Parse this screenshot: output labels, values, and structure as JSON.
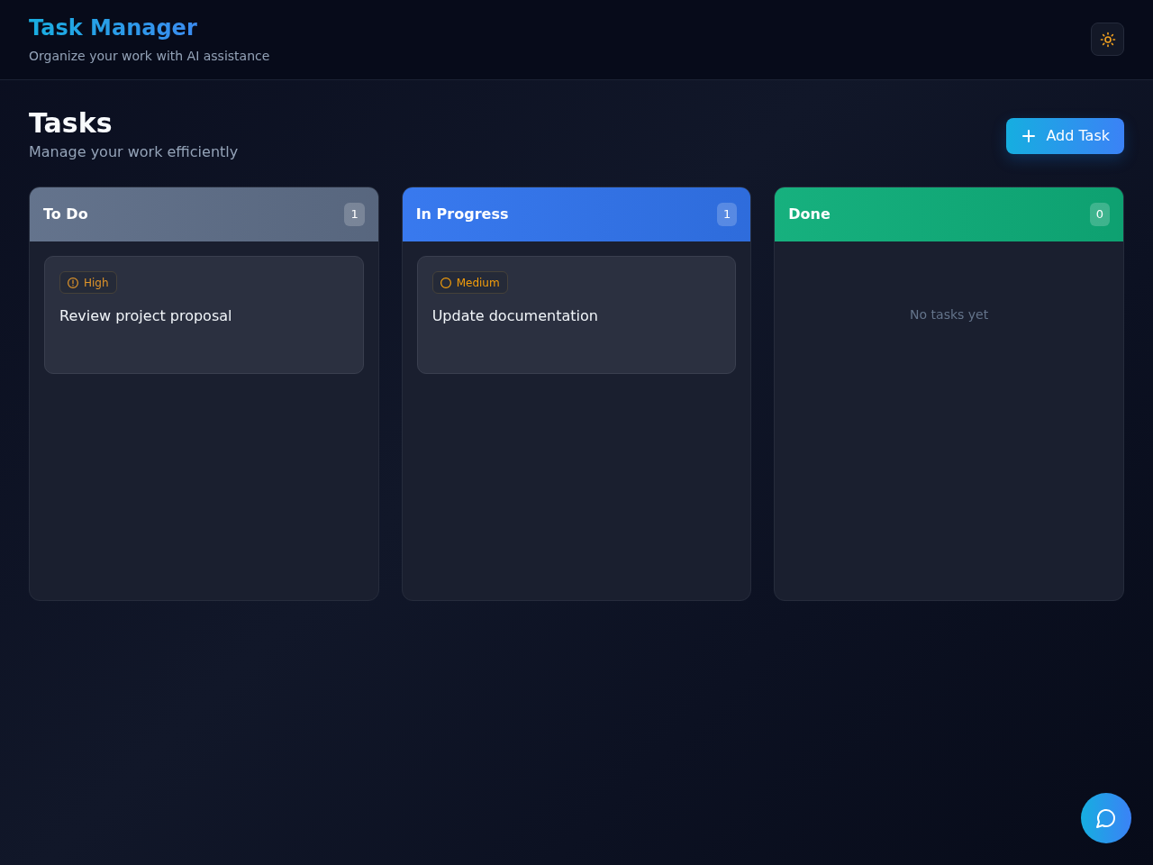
{
  "header": {
    "title": "Task Manager",
    "subtitle": "Organize your work with AI assistance"
  },
  "page": {
    "title": "Tasks",
    "subtitle": "Manage your work efficiently",
    "add_button": "Add Task"
  },
  "columns": [
    {
      "title": "To Do",
      "count": "1",
      "color": "#5f6f89",
      "tasks": [
        {
          "title": "Review project proposal",
          "priority": {
            "label": "High",
            "kind": "high"
          }
        }
      ]
    },
    {
      "title": "In Progress",
      "count": "1",
      "color": "#3275ee",
      "tasks": [
        {
          "title": "Update documentation",
          "priority": {
            "label": "Medium",
            "kind": "medium"
          }
        }
      ]
    },
    {
      "title": "Done",
      "count": "0",
      "color": "#0fae7a",
      "empty_text": "No tasks yet"
    }
  ]
}
